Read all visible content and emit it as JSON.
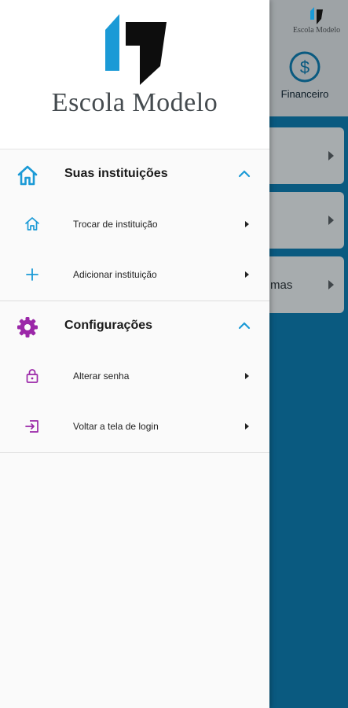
{
  "background": {
    "logo_text": "Escola Modelo",
    "financeiro_label": "Financeiro",
    "card3_partial_text": "mas"
  },
  "drawer": {
    "logo_text": "Escola Modelo",
    "sections": [
      {
        "title": "Suas instituições",
        "icon": "home-icon",
        "color": "#1b9ad6",
        "items": [
          {
            "label": "Trocar de instituição",
            "icon": "home-outline-icon"
          },
          {
            "label": "Adicionar instituição",
            "icon": "plus-icon"
          }
        ]
      },
      {
        "title": "Configurações",
        "icon": "gear-icon",
        "color": "#9b27a8",
        "items": [
          {
            "label": "Alterar senha",
            "icon": "lock-icon"
          },
          {
            "label": "Voltar a tela de login",
            "icon": "login-icon"
          }
        ]
      }
    ]
  },
  "colors": {
    "accent_blue": "#1b9ad6",
    "accent_purple": "#9b27a8",
    "background_teal": "#0a5a80"
  }
}
